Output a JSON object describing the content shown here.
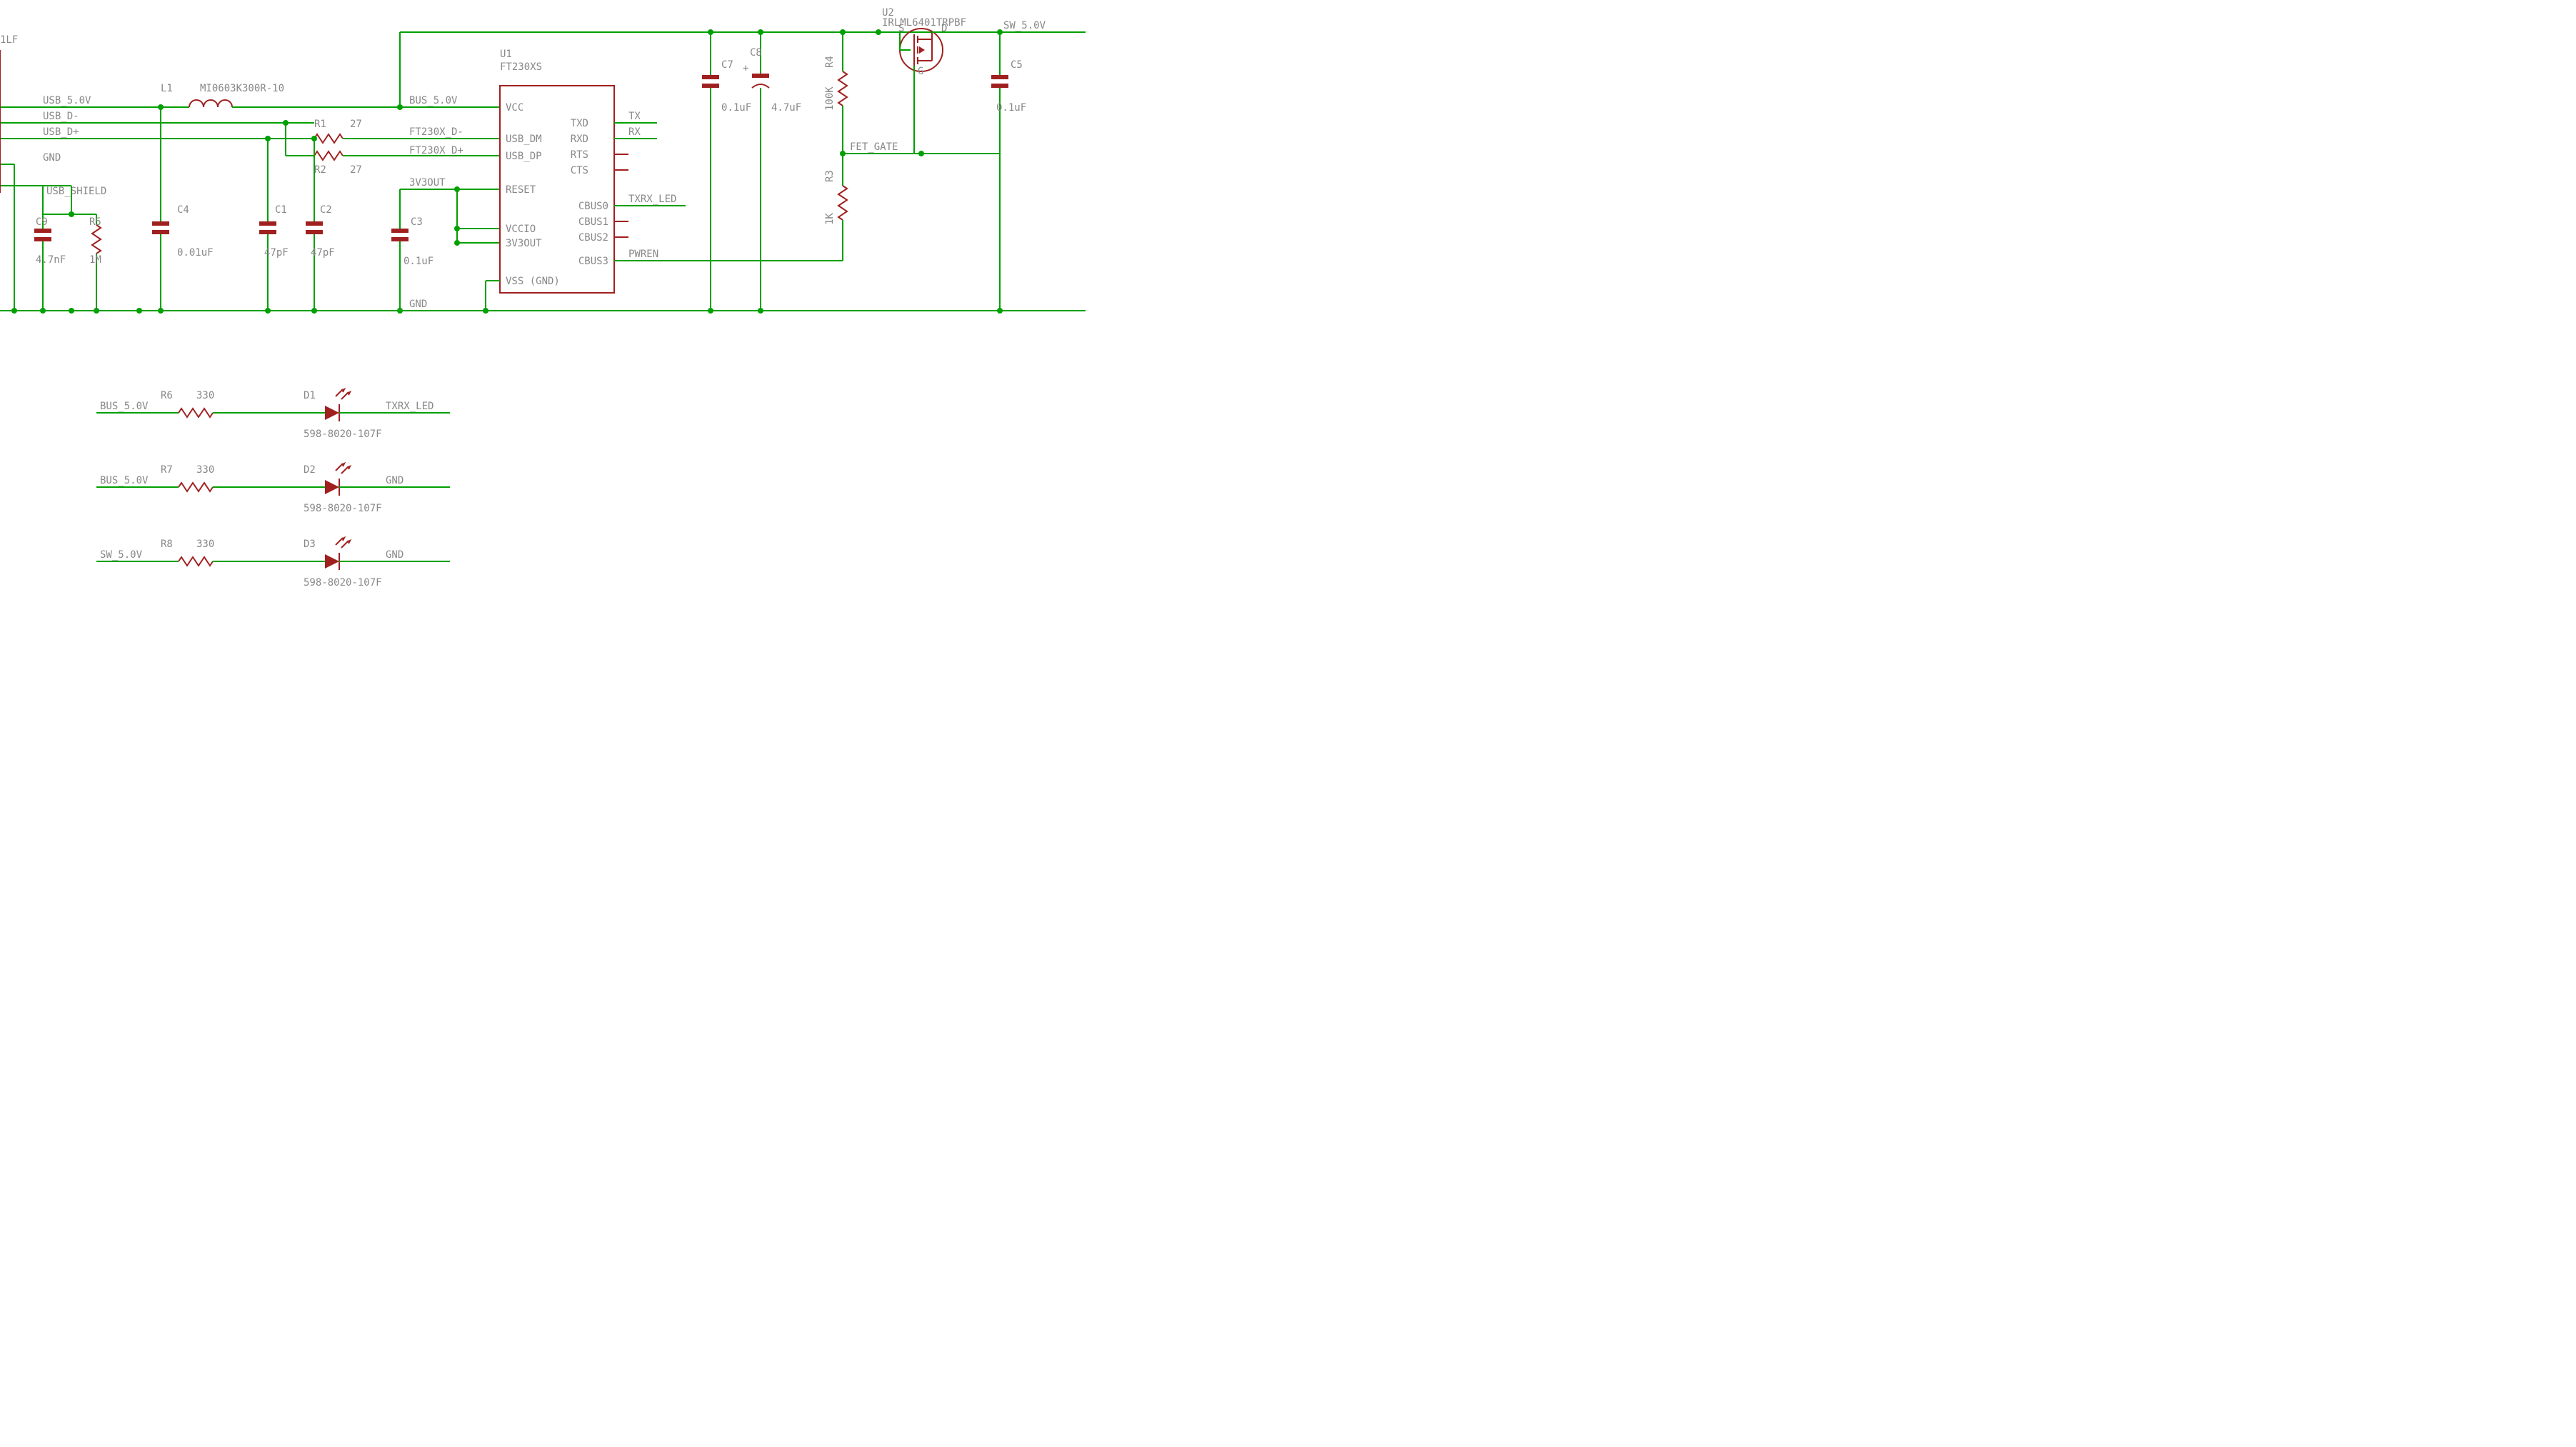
{
  "ic": {
    "u1_ref": "U1",
    "u1_val": "FT230XS",
    "pins_left": [
      "VCC",
      "USB_DM",
      "USB_DP",
      "RESET",
      "VCCIO",
      "3V3OUT",
      "VSS (GND)"
    ],
    "pin_space": "",
    "pins_right": [
      "TXD",
      "RXD",
      "RTS",
      "CTS",
      "CBUS0",
      "CBUS1",
      "CBUS2",
      "CBUS3"
    ]
  },
  "mosfet": {
    "ref": "U2",
    "part": "IRLML6401TRPBF",
    "s": "S",
    "d": "D",
    "g": "G"
  },
  "nets": {
    "usb5v": "USB_5.0V",
    "usbdm": "USB_D-",
    "usbdp": "USB_D+",
    "gnd": "GND",
    "shield": "USB_SHIELD",
    "bus5v": "BUS_5.0V",
    "ft_dm": "FT230X_D-",
    "ft_dp": "FT230X_D+",
    "v3out": "3V3OUT",
    "tx": "TX",
    "rx": "RX",
    "txrxled": "TXRX_LED",
    "pwren": "PWREN",
    "fetgate": "FET_GATE",
    "sw5v": "SW_5.0V",
    "conn": "1LF"
  },
  "L1": {
    "ref": "L1",
    "val": "MI0603K300R-10"
  },
  "R1": {
    "ref": "R1",
    "val": "27"
  },
  "R2": {
    "ref": "R2",
    "val": "27"
  },
  "R3": {
    "ref": "R3",
    "val": "1K"
  },
  "R4": {
    "ref": "R4",
    "val": "100K"
  },
  "R5": {
    "ref": "R5",
    "val": "1M"
  },
  "R6": {
    "ref": "R6",
    "val": "330"
  },
  "R7": {
    "ref": "R7",
    "val": "330"
  },
  "R8": {
    "ref": "R8",
    "val": "330"
  },
  "C1": {
    "ref": "C1",
    "val": "47pF"
  },
  "C2": {
    "ref": "C2",
    "val": "47pF"
  },
  "C3": {
    "ref": "C3",
    "val": "0.1uF"
  },
  "C4": {
    "ref": "C4",
    "val": "0.01uF"
  },
  "C5": {
    "ref": "C5",
    "val": "0.1uF"
  },
  "C7": {
    "ref": "C7",
    "val": "0.1uF"
  },
  "C8": {
    "ref": "C8",
    "val": "4.7uF"
  },
  "C9": {
    "ref": "C9",
    "val": "4.7nF"
  },
  "D1": {
    "ref": "D1",
    "part": "598-8020-107F"
  },
  "D2": {
    "ref": "D2",
    "part": "598-8020-107F"
  },
  "D3": {
    "ref": "D3",
    "part": "598-8020-107F"
  }
}
